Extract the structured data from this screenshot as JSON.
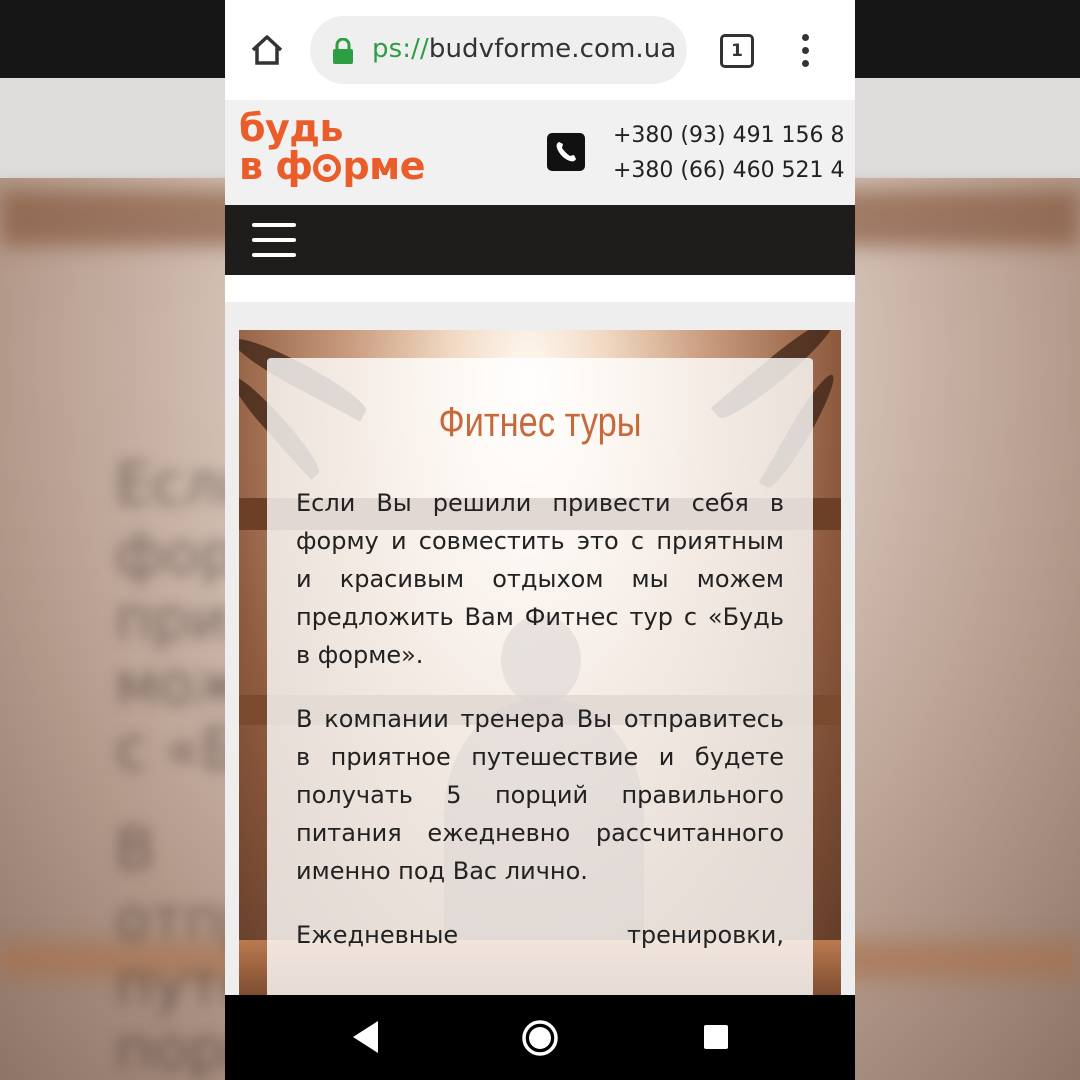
{
  "browser": {
    "url": "budvforme.com.ua",
    "url_scheme_fragment": "ps://",
    "tab_count": "1"
  },
  "header": {
    "logo_line1": "будь",
    "logo_line2_prefix": "в ф",
    "logo_line2_suffix": "рме",
    "phone_1": "+380 (93) 491 156 8",
    "phone_2": "+380 (66) 460 521 4"
  },
  "card": {
    "title": "Фитнес туры",
    "paragraphs": [
      "Если Вы решили привести себя в форму и совместить это с приятным и красивым отдыхом мы можем предложить Вам Фитнес тур с «Будь в форме».",
      "В компании тренера Вы отправитесь в приятное путешествие и будете получать 5 порций правильного питания ежедневно рассчитанного именно под Вас лично.",
      "Ежедневные тренировки,"
    ]
  },
  "background": {
    "blurred_lines": [
      "Если",
      "форм",
      "прия",
      "може",
      "с «Б",
      "В",
      "отпр",
      "путе",
      "порц"
    ]
  },
  "icons": {
    "home": "home-icon",
    "lock": "lock-icon",
    "tabs": "tabs-icon",
    "overflow": "more-vert-icon",
    "phone": "phone-icon",
    "hamburger": "hamburger-menu-icon",
    "back": "back-icon",
    "home_nav": "home-circle-icon",
    "recent": "recent-apps-icon"
  },
  "colors": {
    "brand_orange": "#ea5d2b",
    "title_orange": "#c8693b",
    "secure_green": "#2e9e44",
    "nav_dark": "#1e1d1b"
  }
}
